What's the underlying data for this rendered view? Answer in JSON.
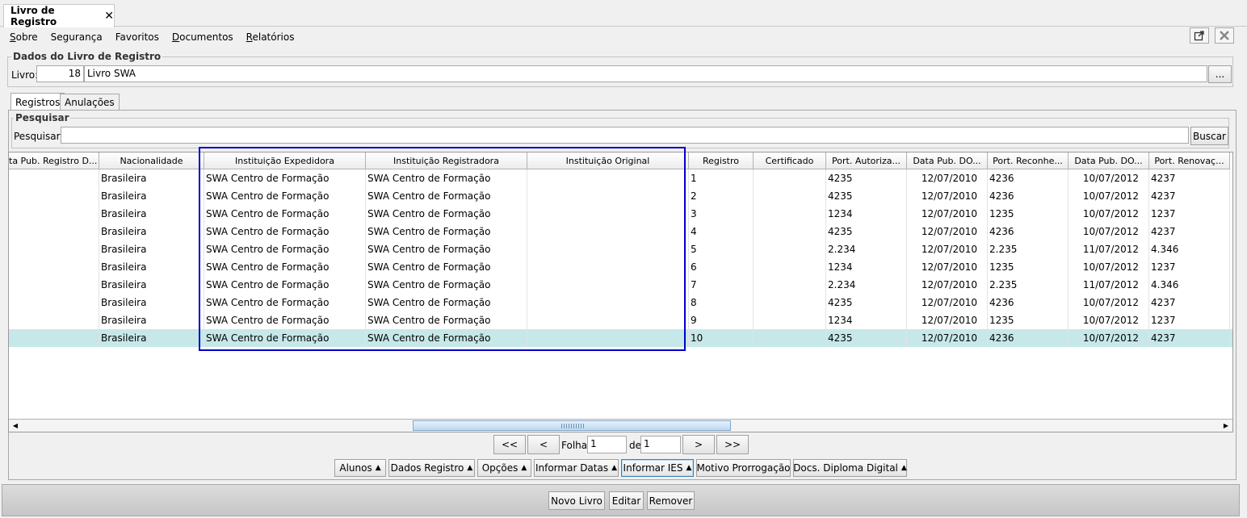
{
  "document_tab": {
    "title": "Livro de Registro",
    "close": "✕"
  },
  "menu": [
    {
      "accel": "S",
      "rest": "obre"
    },
    {
      "accel": "",
      "rest": "Segurança"
    },
    {
      "accel": "",
      "rest": "Favoritos"
    },
    {
      "accel": "D",
      "rest": "ocumentos"
    },
    {
      "accel": "R",
      "rest": "elatórios"
    }
  ],
  "window_buttons": {
    "detach_icon": "external-window-icon",
    "close_icon": "close-icon"
  },
  "livro_section": {
    "legend": "Dados do Livro de Registro",
    "label": "Livro:",
    "code": "18",
    "name": "Livro SWA",
    "browse_label": "..."
  },
  "tabs": [
    "Registros",
    "Anulações"
  ],
  "search": {
    "legend": "Pesquisar",
    "label": "Pesquisar:",
    "value": "",
    "button": "Buscar"
  },
  "columns": [
    "ta Pub. Registro D...",
    "Nacionalidade",
    "Instituição Expedidora",
    "Instituição Registradora",
    "Instituição Original",
    "Registro",
    "Certificado",
    "Port. Autoriza...",
    "Data Pub. DO...",
    "Port. Reconhe...",
    "Data Pub. DO...",
    "Port. Renovaç..."
  ],
  "rows": [
    [
      "",
      "Brasileira",
      "SWA Centro de Formação",
      "SWA Centro de Formação",
      "",
      "1",
      "",
      "4235",
      "12/07/2010",
      "4236",
      "10/07/2012",
      "4237"
    ],
    [
      "",
      "Brasileira",
      "SWA Centro de Formação",
      "SWA Centro de Formação",
      "",
      "2",
      "",
      "4235",
      "12/07/2010",
      "4236",
      "10/07/2012",
      "4237"
    ],
    [
      "",
      "Brasileira",
      "SWA Centro de Formação",
      "SWA Centro de Formação",
      "",
      "3",
      "",
      "1234",
      "12/07/2010",
      "1235",
      "10/07/2012",
      "1237"
    ],
    [
      "",
      "Brasileira",
      "SWA Centro de Formação",
      "SWA Centro de Formação",
      "",
      "4",
      "",
      "4235",
      "12/07/2010",
      "4236",
      "10/07/2012",
      "4237"
    ],
    [
      "",
      "Brasileira",
      "SWA Centro de Formação",
      "SWA Centro de Formação",
      "",
      "5",
      "",
      "2.234",
      "12/07/2010",
      "2.235",
      "11/07/2012",
      "4.346"
    ],
    [
      "",
      "Brasileira",
      "SWA Centro de Formação",
      "SWA Centro de Formação",
      "",
      "6",
      "",
      "1234",
      "12/07/2010",
      "1235",
      "10/07/2012",
      "1237"
    ],
    [
      "",
      "Brasileira",
      "SWA Centro de Formação",
      "SWA Centro de Formação",
      "",
      "7",
      "",
      "2.234",
      "12/07/2010",
      "2.235",
      "11/07/2012",
      "4.346"
    ],
    [
      "",
      "Brasileira",
      "SWA Centro de Formação",
      "SWA Centro de Formação",
      "",
      "8",
      "",
      "4235",
      "12/07/2010",
      "4236",
      "10/07/2012",
      "4237"
    ],
    [
      "",
      "Brasileira",
      "SWA Centro de Formação",
      "SWA Centro de Formação",
      "",
      "9",
      "",
      "1234",
      "12/07/2010",
      "1235",
      "10/07/2012",
      "1237"
    ],
    [
      "",
      "Brasileira",
      "SWA Centro de Formação",
      "SWA Centro de Formação",
      "",
      "10",
      "",
      "4235",
      "12/07/2010",
      "4236",
      "10/07/2012",
      "4237"
    ]
  ],
  "selected_row_index": 9,
  "pagination": {
    "first": "<<",
    "prev": "<",
    "folha_label": "Folha",
    "page": "1",
    "de_label": "de",
    "total": "1",
    "next": ">",
    "last": ">>"
  },
  "actions": [
    {
      "label": "Alunos",
      "caret": "▲"
    },
    {
      "label": "Dados Registro",
      "caret": "▲"
    },
    {
      "label": "Opções",
      "caret": "▲"
    },
    {
      "label": "Informar Datas",
      "caret": "▲"
    },
    {
      "label": "Informar IES",
      "caret": "▲"
    },
    {
      "label": "Motivo Prorrogação",
      "caret": ""
    },
    {
      "label": "Docs. Diploma Digital",
      "caret": "▲"
    }
  ],
  "footer_buttons": [
    "Novo Livro",
    "Editar",
    "Remover"
  ],
  "colors": {
    "highlight_border": "#0000cc",
    "selected_row": "#c6e8e8"
  }
}
